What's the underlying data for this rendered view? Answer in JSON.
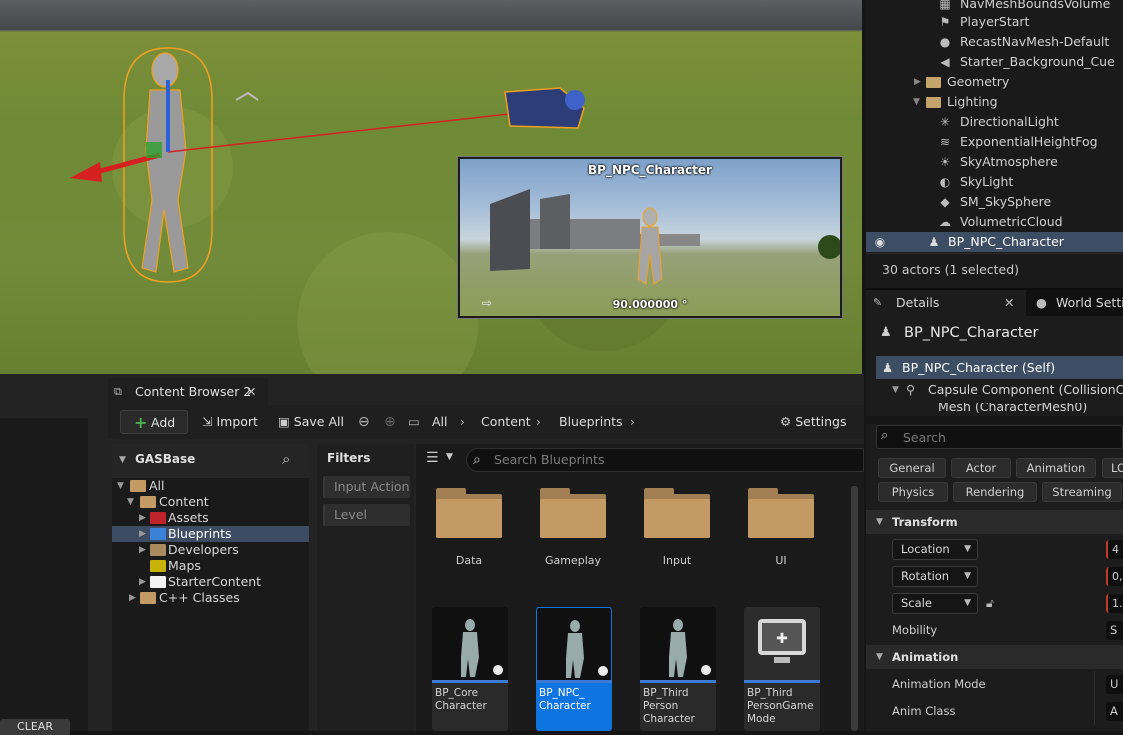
{
  "viewport": {
    "pip_title": "BP_NPC_Character",
    "pip_angle": "90.000000 °"
  },
  "outliner": {
    "items": [
      {
        "label": "NavMeshBoundsVolume",
        "icon": "volume-icon"
      },
      {
        "label": "PlayerStart",
        "icon": "player-start-icon"
      },
      {
        "label": "RecastNavMesh-Default",
        "icon": "navmesh-icon"
      },
      {
        "label": "Starter_Background_Cue",
        "icon": "speaker-icon"
      },
      {
        "label": "Geometry",
        "icon": "folder-icon"
      },
      {
        "label": "Lighting",
        "icon": "folder-icon"
      },
      {
        "label": "DirectionalLight",
        "icon": "sun-icon"
      },
      {
        "label": "ExponentialHeightFog",
        "icon": "fog-icon"
      },
      {
        "label": "SkyAtmosphere",
        "icon": "atmosphere-icon"
      },
      {
        "label": "SkyLight",
        "icon": "skylight-icon"
      },
      {
        "label": "SM_SkySphere",
        "icon": "mesh-icon"
      },
      {
        "label": "VolumetricCloud",
        "icon": "cloud-icon"
      },
      {
        "label": "BP_NPC_Character",
        "icon": "pawn-icon"
      }
    ],
    "actor_count": "30 actors (1 selected)"
  },
  "details": {
    "tab_details": "Details",
    "tab_world": "World Settings",
    "title": "BP_NPC_Character",
    "self_row": "BP_NPC_Character (Self)",
    "capsule_row": "Capsule Component (CollisionCylinder)",
    "mesh_row": "Mesh (CharacterMesh0)",
    "search_placeholder": "Search",
    "filters_row1": [
      "General",
      "Actor",
      "Animation",
      "LOD"
    ],
    "filters_row2": [
      "Physics",
      "Rendering",
      "Streaming"
    ],
    "transform_header": "Transform",
    "location_label": "Location",
    "location_value": "4",
    "rotation_label": "Rotation",
    "rotation_value": "0,",
    "scale_label": "Scale",
    "scale_value": "1.",
    "mobility_label": "Mobility",
    "mobility_value": "S",
    "animation_header": "Animation",
    "anim_mode_label": "Animation Mode",
    "anim_mode_value": "U",
    "anim_class_label": "Anim Class",
    "anim_class_value": "A"
  },
  "bottom_left": {
    "clear_label": "CLEAR"
  },
  "content_browser": {
    "tab_title": "Content Browser 2",
    "toolbar": {
      "add_label": "Add",
      "import_label": "Import",
      "save_all_label": "Save All",
      "settings_label": "Settings"
    },
    "breadcrumb": [
      "All",
      "Content",
      "Blueprints"
    ],
    "sources_title": "GASBase",
    "tree": [
      {
        "label": "All",
        "color": "#c49a64"
      },
      {
        "label": "Content",
        "color": "#c49a64"
      },
      {
        "label": "Assets",
        "color": "#c0242b"
      },
      {
        "label": "Blueprints",
        "color": "#3a82d8"
      },
      {
        "label": "Developers",
        "color": "#a88a5e"
      },
      {
        "label": "Maps",
        "color": "#c7b20a"
      },
      {
        "label": "StarterContent",
        "color": "#f2f2f2"
      },
      {
        "label": "C++ Classes",
        "color": "#c49a64"
      }
    ],
    "filters_title": "Filters",
    "filter_chips": [
      "Input Action",
      "Level"
    ],
    "search_placeholder": "Search Blueprints",
    "folders": [
      "Data",
      "Gameplay",
      "Input",
      "UI"
    ],
    "assets": [
      {
        "label": "BP_Core Character"
      },
      {
        "label": "BP_NPC_ Character"
      },
      {
        "label": "BP_Third Person Character"
      },
      {
        "label": "BP_Third PersonGame Mode"
      }
    ]
  },
  "colors": {
    "selection": "#3c4d64",
    "accent_blue": "#0e74e0",
    "thumbnail_bar": "#3b7bd5"
  }
}
